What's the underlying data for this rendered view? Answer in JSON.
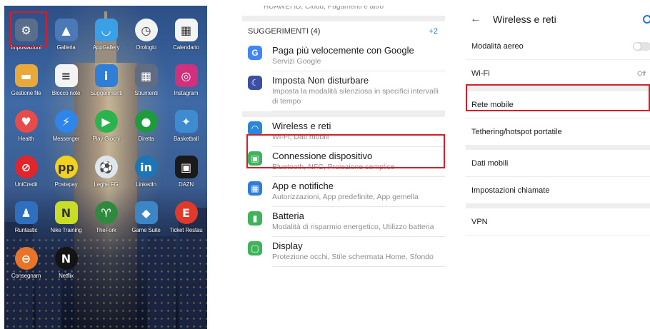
{
  "home": {
    "apps": [
      {
        "label": "Impostazioni",
        "icon": "settings-icon",
        "color": "#5a6e8c",
        "glyph": "⚙"
      },
      {
        "label": "Galleria",
        "icon": "gallery-icon",
        "color": "#4b79b8",
        "glyph": "▲"
      },
      {
        "label": "AppGallery",
        "icon": "appgallery-icon",
        "color": "#3aa0e6",
        "glyph": "◡"
      },
      {
        "label": "Orologio",
        "icon": "clock-icon",
        "color": "#f2f2f2",
        "glyph": "◷"
      },
      {
        "label": "Calendario",
        "icon": "calendar-icon",
        "color": "#f4f4f4",
        "glyph": "▦"
      },
      {
        "label": "Gestione file",
        "icon": "folder-icon",
        "color": "#e8a93a",
        "glyph": "▬"
      },
      {
        "label": "Blocco note",
        "icon": "notepad-icon",
        "color": "#f3f3f3",
        "glyph": "≡"
      },
      {
        "label": "Suggerimenti",
        "icon": "tips-icon",
        "color": "#2f7ed8",
        "glyph": "i"
      },
      {
        "label": "Strumenti",
        "icon": "tools-icon",
        "color": "#5f6c82",
        "glyph": "▦"
      },
      {
        "label": "Instagram",
        "icon": "instagram-icon",
        "color": "#d0307c",
        "glyph": "◎"
      },
      {
        "label": "Health",
        "icon": "health-icon",
        "color": "#e94b4b",
        "glyph": "♥"
      },
      {
        "label": "Messenger",
        "icon": "messenger-icon",
        "color": "#2f86ea",
        "glyph": "⚡"
      },
      {
        "label": "Play Giochi",
        "icon": "play-games-icon",
        "color": "#2bb34d",
        "glyph": "▶"
      },
      {
        "label": "Diretta",
        "icon": "diretta-icon",
        "color": "#1f9a3c",
        "glyph": "●"
      },
      {
        "label": "Basketball",
        "icon": "basketball-icon",
        "color": "#3e8bd0",
        "glyph": "✦"
      },
      {
        "label": "UniCredit",
        "icon": "unicredit-icon",
        "color": "#e1252b",
        "glyph": "⊘"
      },
      {
        "label": "Postepay",
        "icon": "postepay-icon",
        "color": "#f2d21c",
        "glyph": "pp"
      },
      {
        "label": "Leghe FG",
        "icon": "fantacalcio-icon",
        "color": "#dfe7ee",
        "glyph": "⚽"
      },
      {
        "label": "LinkedIn",
        "icon": "linkedin-icon",
        "color": "#1b75b6",
        "glyph": "in"
      },
      {
        "label": "DAZN",
        "icon": "dazn-icon",
        "color": "#1a1a1a",
        "glyph": "▣"
      },
      {
        "label": "Runtastic",
        "icon": "runtastic-icon",
        "color": "#2e6fbf",
        "glyph": "♟"
      },
      {
        "label": "Nike Training",
        "icon": "nike-training-icon",
        "color": "#c8dd25",
        "glyph": "N"
      },
      {
        "label": "TheFork",
        "icon": "thefork-icon",
        "color": "#2e8a3f",
        "glyph": "♈"
      },
      {
        "label": "Game Suite",
        "icon": "game-suite-icon",
        "color": "#3d86c6",
        "glyph": "◆"
      },
      {
        "label": "Ticket Restau",
        "icon": "ticket-icon",
        "color": "#e13a2a",
        "glyph": "E"
      },
      {
        "label": "Consegnam",
        "icon": "consegna-icon",
        "color": "#e8742a",
        "glyph": "⊖"
      },
      {
        "label": "Netflix",
        "icon": "netflix-icon",
        "color": "#141414",
        "glyph": "N"
      }
    ]
  },
  "settings": {
    "top_partial": "HUAWEI ID, Cloud, Pagamenti e altro",
    "suggestions_header": "SUGGERIMENTI (4)",
    "suggestions_more": "+2",
    "items": [
      {
        "title": "Paga più velocemente con Google",
        "subtitle": "Servizi Google",
        "icon": "google-icon",
        "color": "#4285f4",
        "glyph": "G"
      },
      {
        "title": "Imposta Non disturbare",
        "subtitle": "Imposta la modalità silenziosa in specifici intervalli di tempo",
        "icon": "moon-icon",
        "color": "#3e4fa3",
        "glyph": "☾"
      },
      {
        "title": "Wireless e reti",
        "subtitle": "Wi-Fi, Dati mobili",
        "icon": "wifi-icon",
        "color": "#2b86d8",
        "glyph": "◠"
      },
      {
        "title": "Connessione dispositivo",
        "subtitle": "Bluetooth, NFC, Proiezione semplice",
        "icon": "device-connection-icon",
        "color": "#3fb35c",
        "glyph": "▣"
      },
      {
        "title": "App e notifiche",
        "subtitle": "Autorizzazioni, App predefinite, App gemella",
        "icon": "apps-icon",
        "color": "#2d7ed4",
        "glyph": "▦"
      },
      {
        "title": "Batteria",
        "subtitle": "Modalità di risparmio energetico, Utilizzo batteria",
        "icon": "battery-icon",
        "color": "#3fb35c",
        "glyph": "▮"
      },
      {
        "title": "Display",
        "subtitle": "Protezione occhi, Stile schermata Home, Sfondo",
        "icon": "display-icon",
        "color": "#3fb35c",
        "glyph": "▢"
      }
    ]
  },
  "wireless": {
    "title": "Wireless e reti",
    "rows": [
      {
        "label": "Modalità aereo",
        "value": ""
      },
      {
        "label": "Wi-Fi",
        "value": "Off"
      },
      {
        "label": "Rete mobile",
        "value": ""
      },
      {
        "label": "Tethering/hotspot portatile",
        "value": ""
      },
      {
        "label": "Dati mobili",
        "value": ""
      },
      {
        "label": "Impostazioni chiamate",
        "value": ""
      },
      {
        "label": "VPN",
        "value": ""
      }
    ]
  }
}
